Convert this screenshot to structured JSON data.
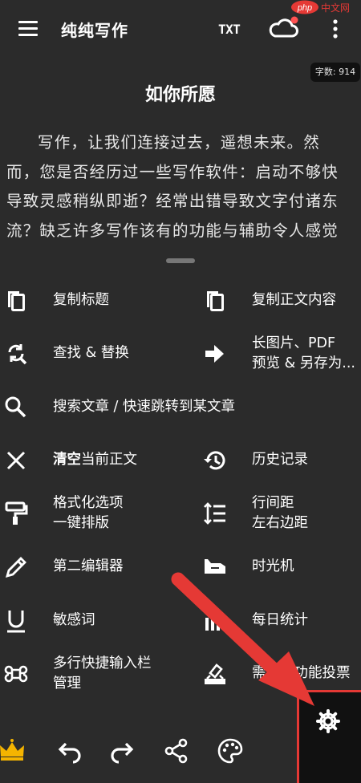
{
  "header": {
    "app_title": "纯纯写作",
    "txt_label": "TXT",
    "watermark": "php 中文网"
  },
  "document": {
    "word_count": "字数: 914",
    "title": "如你所愿",
    "body": "写作，让我们连接过去，遥想未来。然而，您是否经历过一些写作软件：启动不够快导致灵感稍纵即逝？经常出错导致文字付诸东流？缺乏许多写作该有的功能与辅助令人感觉"
  },
  "menu": {
    "copy_title": "复制标题",
    "copy_body": "复制正文内容",
    "find_replace": "查找 & 替换",
    "long_image_1": "长图片、PDF",
    "long_image_2": "预览 & 另存为...",
    "search_articles": "搜索文章 / 快速跳转到某文章",
    "clear_bold": "清空",
    "clear_rest": "当前正文",
    "history": "历史记录",
    "format_1": "格式化选项",
    "format_2": "一键排版",
    "spacing_1": "行间距",
    "spacing_2": "左右边距",
    "second_editor": "第二编辑器",
    "time_machine": "时光机",
    "sensitive_words": "敏感词",
    "daily_stats": "每日统计",
    "shortcut_1": "多行快捷输入栏",
    "shortcut_2": "管理",
    "vote": "需求式功能投票"
  },
  "colors": {
    "background": "#2b2b2b",
    "text": "#ffffff",
    "arrow": "#e53935",
    "cloud_dot": "#ff5252",
    "crown": "#f5b400"
  }
}
